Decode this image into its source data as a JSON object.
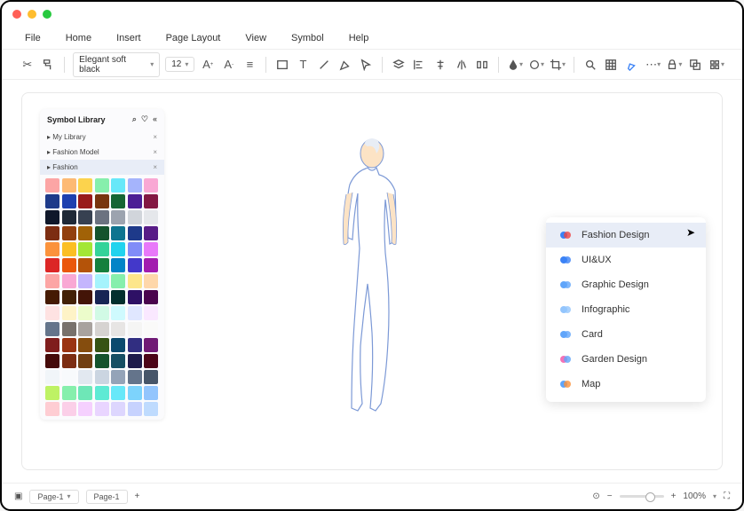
{
  "menubar": [
    "File",
    "Home",
    "Insert",
    "Page Layout",
    "View",
    "Symbol",
    "Help"
  ],
  "toolbar": {
    "font": "Elegant soft black",
    "size": "12"
  },
  "sidebar": {
    "title": "Symbol Library",
    "cats": [
      {
        "label": "My Library",
        "active": false
      },
      {
        "label": "Fashion Model",
        "active": false
      },
      {
        "label": "Fashion",
        "active": true
      }
    ]
  },
  "context": [
    {
      "label": "Fashion Design",
      "active": true,
      "c1": "#3b82f6",
      "c2": "#ef4444"
    },
    {
      "label": "UI&UX",
      "active": false,
      "c1": "#3b82f6",
      "c2": "#3b82f6"
    },
    {
      "label": "Graphic Design",
      "active": false,
      "c1": "#60a5fa",
      "c2": "#60a5fa"
    },
    {
      "label": "Infographic",
      "active": false,
      "c1": "#93c5fd",
      "c2": "#93c5fd"
    },
    {
      "label": "Card",
      "active": false,
      "c1": "#60a5fa",
      "c2": "#60a5fa"
    },
    {
      "label": "Garden Design",
      "active": false,
      "c1": "#f472b6",
      "c2": "#60a5fa"
    },
    {
      "label": "Map",
      "active": false,
      "c1": "#60a5fa",
      "c2": "#fb923c"
    }
  ],
  "status": {
    "page": "Page-1",
    "tab": "Page-1",
    "zoom": "100%"
  },
  "palette": [
    "#fca5a5",
    "#fdba74",
    "#fcd34d",
    "#86efac",
    "#67e8f9",
    "#a5b4fc",
    "#f9a8d4",
    "#1e3a8a",
    "#1e40af",
    "#991b1b",
    "#78350f",
    "#166534",
    "#4c1d95",
    "#831843",
    "#0f172a",
    "#1f2937",
    "#374151",
    "#6b7280",
    "#9ca3af",
    "#d1d5db",
    "#e5e7eb",
    "#7c2d12",
    "#92400e",
    "#a16207",
    "#14532d",
    "#0e7490",
    "#1e3a8a",
    "#581c87",
    "#fb923c",
    "#fbbf24",
    "#a3e635",
    "#34d399",
    "#22d3ee",
    "#818cf8",
    "#e879f9",
    "#dc2626",
    "#ea580c",
    "#b45309",
    "#15803d",
    "#0284c7",
    "#4338ca",
    "#a21caf",
    "#fca5a5",
    "#f9a8d4",
    "#c4b5fd",
    "#a5f3fc",
    "#86efac",
    "#fde68a",
    "#fed7aa",
    "#451a03",
    "#422006",
    "#431407",
    "#172554",
    "#042f2e",
    "#2e1065",
    "#4a044e",
    "#fee2e2",
    "#fef3c7",
    "#ecfccb",
    "#d1fae5",
    "#cffafe",
    "#e0e7ff",
    "#fae8ff",
    "#64748b",
    "#78716c",
    "#a8a29e",
    "#d6d3d1",
    "#e7e5e4",
    "#f5f5f4",
    "#fafaf9",
    "#7f1d1d",
    "#9a3412",
    "#854d0e",
    "#365314",
    "#0c4a6e",
    "#312e81",
    "#701a75",
    "#450a0a",
    "#7c2d12",
    "#713f12",
    "#14532d",
    "#164e63",
    "#1e1b4b",
    "#4c0519",
    "#f1f5f9",
    "#f8fafc",
    "#e2e8f0",
    "#cbd5e1",
    "#94a3b8",
    "#64748b",
    "#475569",
    "#bef264",
    "#86efac",
    "#6ee7b7",
    "#5eead4",
    "#67e8f9",
    "#7dd3fc",
    "#93c5fd",
    "#fecdd3",
    "#fbcfe8",
    "#f5d0fe",
    "#e9d5ff",
    "#ddd6fe",
    "#c7d2fe",
    "#bfdbfe"
  ]
}
